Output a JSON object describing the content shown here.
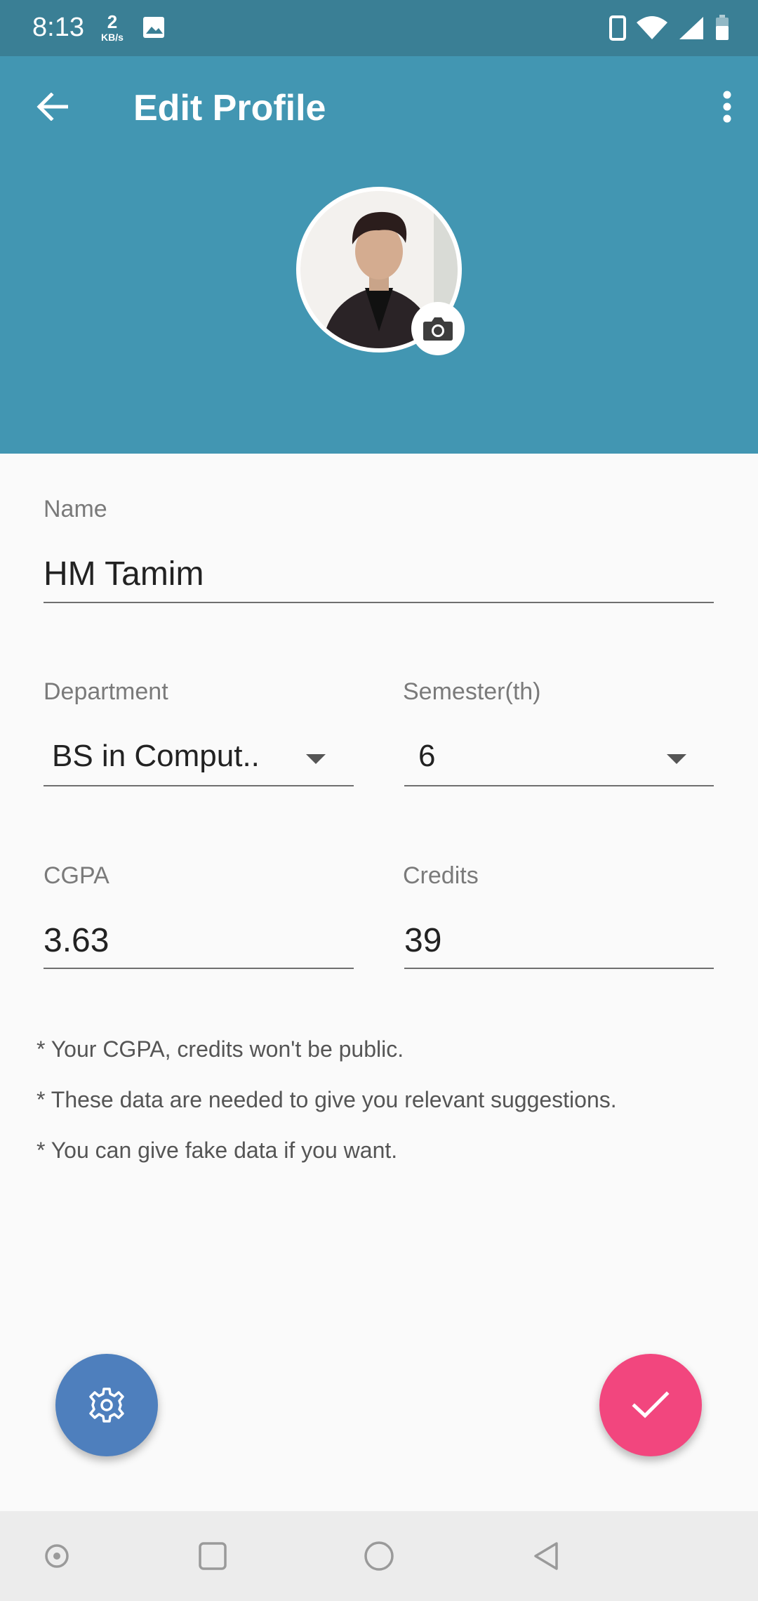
{
  "status_bar": {
    "time": "8:13",
    "net_speed_value": "2",
    "net_speed_unit": "KB/s"
  },
  "header": {
    "title": "Edit Profile"
  },
  "form": {
    "name": {
      "label": "Name",
      "value": "HM Tamim"
    },
    "department": {
      "label": "Department",
      "value": "BS in Comput.."
    },
    "semester": {
      "label": "Semester(th)",
      "value": "6"
    },
    "cgpa": {
      "label": "CGPA",
      "value": "3.63"
    },
    "credits": {
      "label": "Credits",
      "value": "39"
    }
  },
  "notes": [
    "* Your CGPA, credits won't be public.",
    "* These data are needed to give you relevant suggestions.",
    "* You can give fake data if you want."
  ],
  "colors": {
    "status_bar": "#3a7f95",
    "header": "#4296b2",
    "fab_settings": "#4e7fbd",
    "fab_save": "#f2467e",
    "background": "#fafafa"
  },
  "icons": [
    "back-arrow-icon",
    "more-vert-icon",
    "camera-icon",
    "gear-icon",
    "check-icon"
  ]
}
